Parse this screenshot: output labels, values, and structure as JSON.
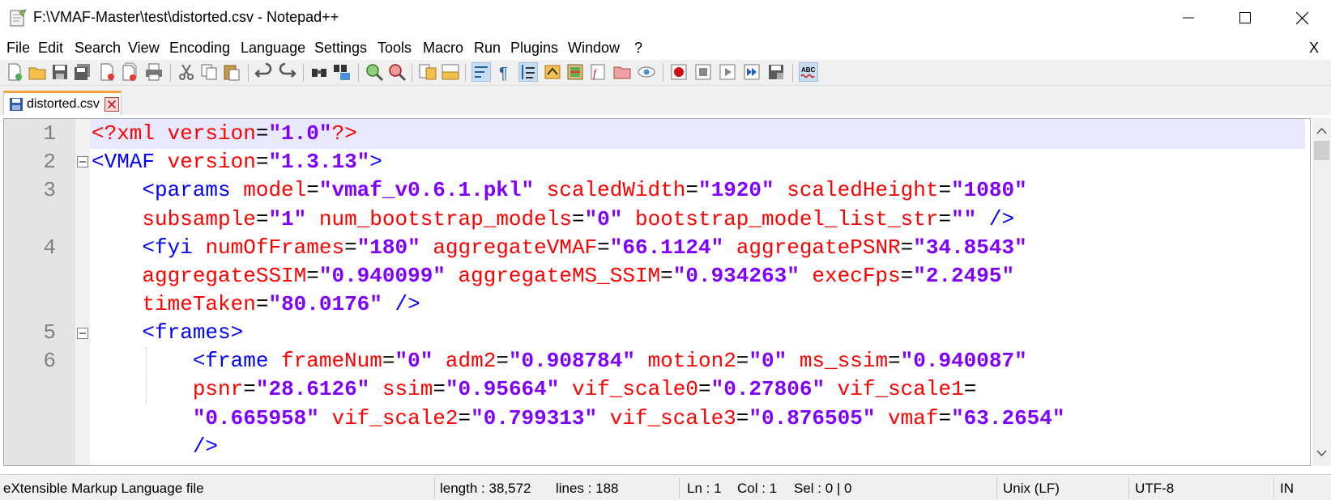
{
  "window": {
    "title": "F:\\VMAF-Master\\test\\distorted.csv - Notepad++"
  },
  "menu": {
    "items": [
      "File",
      "Edit",
      "Search",
      "View",
      "Encoding",
      "Language",
      "Settings",
      "Tools",
      "Macro",
      "Run",
      "Plugins",
      "Window",
      "?"
    ],
    "close_doc": "X"
  },
  "toolbar": {
    "icons": [
      "new-file-icon",
      "open-file-icon",
      "save-icon",
      "save-all-icon",
      "close-icon",
      "close-all-icon",
      "print-icon",
      "cut-icon",
      "copy-icon",
      "paste-icon",
      "undo-icon",
      "redo-icon",
      "find-icon",
      "replace-icon",
      "zoom-in-icon",
      "zoom-out-icon",
      "sync-vertical-icon",
      "sync-horizontal-icon",
      "word-wrap-icon",
      "show-all-chars-icon",
      "indent-guide-icon",
      "user-language-icon",
      "doc-map-icon",
      "function-list-icon",
      "folder-workspace-icon",
      "monitoring-icon",
      "record-macro-icon",
      "stop-record-icon",
      "playback-macro-icon",
      "run-macro-multiple-icon",
      "save-macro-icon",
      "spell-check-icon"
    ]
  },
  "tabs": [
    {
      "label": "distorted.csv",
      "active": true
    }
  ],
  "editor": {
    "line_numbers": [
      "1",
      "2",
      "3",
      "4",
      "5",
      "6"
    ],
    "lines": [
      [
        [
          "pi",
          "<?xml "
        ],
        [
          "attr",
          "version"
        ],
        [
          "eq",
          "="
        ],
        [
          "val",
          "\"1.0\""
        ],
        [
          "pi",
          "?>"
        ]
      ],
      [
        [
          "tag",
          "<VMAF "
        ],
        [
          "attr",
          "version"
        ],
        [
          "eq",
          "="
        ],
        [
          "val",
          "\"1.3.13\""
        ],
        [
          "tag",
          ">"
        ]
      ],
      [
        [
          "plain",
          "    "
        ],
        [
          "tag",
          "<params "
        ],
        [
          "attr",
          "model"
        ],
        [
          "eq",
          "="
        ],
        [
          "val",
          "\"vmaf_v0.6.1.pkl\""
        ],
        [
          "plain",
          " "
        ],
        [
          "attr",
          "scaledWidth"
        ],
        [
          "eq",
          "="
        ],
        [
          "val",
          "\"1920\""
        ],
        [
          "plain",
          " "
        ],
        [
          "attr",
          "scaledHeight"
        ],
        [
          "eq",
          "="
        ],
        [
          "val",
          "\"1080\""
        ]
      ],
      [
        [
          "plain",
          "    "
        ],
        [
          "attr",
          "subsample"
        ],
        [
          "eq",
          "="
        ],
        [
          "val",
          "\"1\""
        ],
        [
          "plain",
          " "
        ],
        [
          "attr",
          "num_bootstrap_models"
        ],
        [
          "eq",
          "="
        ],
        [
          "val",
          "\"0\""
        ],
        [
          "plain",
          " "
        ],
        [
          "attr",
          "bootstrap_model_list_str"
        ],
        [
          "eq",
          "="
        ],
        [
          "val",
          "\"\""
        ],
        [
          "plain",
          " "
        ],
        [
          "tag",
          "/>"
        ]
      ],
      [
        [
          "plain",
          "    "
        ],
        [
          "tag",
          "<fyi "
        ],
        [
          "attr",
          "numOfFrames"
        ],
        [
          "eq",
          "="
        ],
        [
          "val",
          "\"180\""
        ],
        [
          "plain",
          " "
        ],
        [
          "attr",
          "aggregateVMAF"
        ],
        [
          "eq",
          "="
        ],
        [
          "val",
          "\"66.1124\""
        ],
        [
          "plain",
          " "
        ],
        [
          "attr",
          "aggregatePSNR"
        ],
        [
          "eq",
          "="
        ],
        [
          "val",
          "\"34.8543\""
        ]
      ],
      [
        [
          "plain",
          "    "
        ],
        [
          "attr",
          "aggregateSSIM"
        ],
        [
          "eq",
          "="
        ],
        [
          "val",
          "\"0.940099\""
        ],
        [
          "plain",
          " "
        ],
        [
          "attr",
          "aggregateMS_SSIM"
        ],
        [
          "eq",
          "="
        ],
        [
          "val",
          "\"0.934263\""
        ],
        [
          "plain",
          " "
        ],
        [
          "attr",
          "execFps"
        ],
        [
          "eq",
          "="
        ],
        [
          "val",
          "\"2.2495\""
        ]
      ],
      [
        [
          "plain",
          "    "
        ],
        [
          "attr",
          "timeTaken"
        ],
        [
          "eq",
          "="
        ],
        [
          "val",
          "\"80.0176\""
        ],
        [
          "plain",
          " "
        ],
        [
          "tag",
          "/>"
        ]
      ],
      [
        [
          "plain",
          "    "
        ],
        [
          "tag",
          "<frames>"
        ]
      ],
      [
        [
          "plain",
          "        "
        ],
        [
          "tag",
          "<frame "
        ],
        [
          "attr",
          "frameNum"
        ],
        [
          "eq",
          "="
        ],
        [
          "val",
          "\"0\""
        ],
        [
          "plain",
          " "
        ],
        [
          "attr",
          "adm2"
        ],
        [
          "eq",
          "="
        ],
        [
          "val",
          "\"0.908784\""
        ],
        [
          "plain",
          " "
        ],
        [
          "attr",
          "motion2"
        ],
        [
          "eq",
          "="
        ],
        [
          "val",
          "\"0\""
        ],
        [
          "plain",
          " "
        ],
        [
          "attr",
          "ms_ssim"
        ],
        [
          "eq",
          "="
        ],
        [
          "val",
          "\"0.940087\""
        ]
      ],
      [
        [
          "plain",
          "        "
        ],
        [
          "attr",
          "psnr"
        ],
        [
          "eq",
          "="
        ],
        [
          "val",
          "\"28.6126\""
        ],
        [
          "plain",
          " "
        ],
        [
          "attr",
          "ssim"
        ],
        [
          "eq",
          "="
        ],
        [
          "val",
          "\"0.95664\""
        ],
        [
          "plain",
          " "
        ],
        [
          "attr",
          "vif_scale0"
        ],
        [
          "eq",
          "="
        ],
        [
          "val",
          "\"0.27806\""
        ],
        [
          "plain",
          " "
        ],
        [
          "attr",
          "vif_scale1"
        ],
        [
          "eq",
          "="
        ]
      ],
      [
        [
          "plain",
          "        "
        ],
        [
          "val",
          "\"0.665958\""
        ],
        [
          "plain",
          " "
        ],
        [
          "attr",
          "vif_scale2"
        ],
        [
          "eq",
          "="
        ],
        [
          "val",
          "\"0.799313\""
        ],
        [
          "plain",
          " "
        ],
        [
          "attr",
          "vif_scale3"
        ],
        [
          "eq",
          "="
        ],
        [
          "val",
          "\"0.876505\""
        ],
        [
          "plain",
          " "
        ],
        [
          "attr",
          "vmaf"
        ],
        [
          "eq",
          "="
        ],
        [
          "val",
          "\"63.2654\""
        ]
      ],
      [
        [
          "plain",
          "        "
        ],
        [
          "tag",
          "/>"
        ]
      ]
    ]
  },
  "status": {
    "file_type": "eXtensible Markup Language file",
    "length": "length : 38,572",
    "lines": "lines : 188",
    "ln": "Ln : 1",
    "col": "Col : 1",
    "sel": "Sel : 0 | 0",
    "eol": "Unix (LF)",
    "encoding": "UTF-8",
    "mode": "IN"
  }
}
